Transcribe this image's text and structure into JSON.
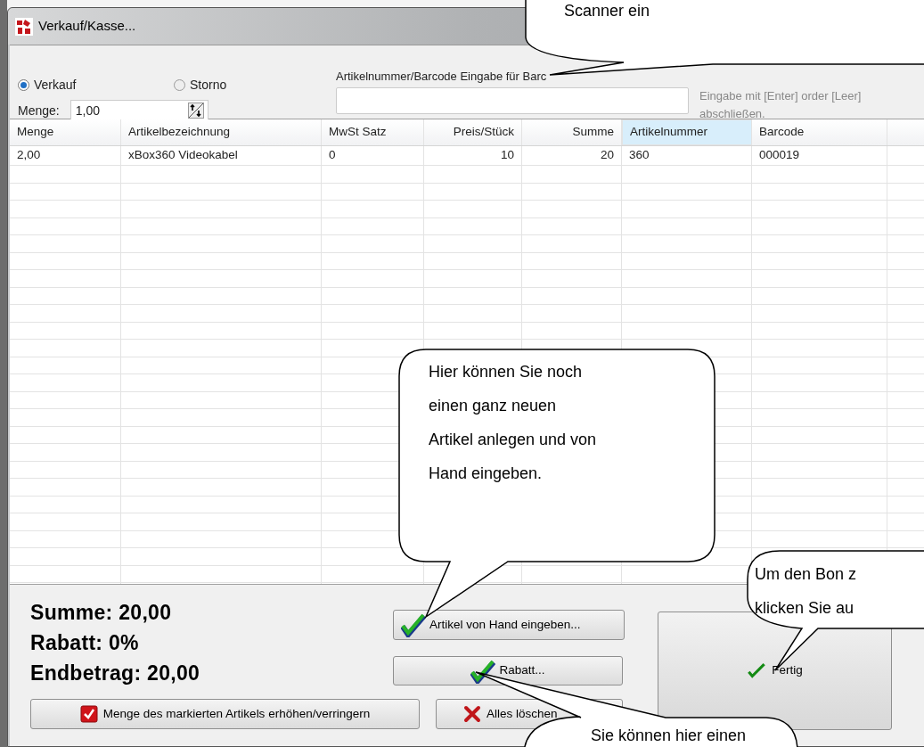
{
  "window": {
    "title": "Verkauf/Kasse..."
  },
  "mode_options": [
    {
      "label": "Verkauf",
      "selected": true
    },
    {
      "label": "Storno",
      "selected": false
    }
  ],
  "quantity": {
    "label": "Menge:",
    "value": "1,00"
  },
  "article_input": {
    "label": "Artikelnummer/Barcode Eingabe für Barc",
    "hint": "Eingabe mit [Enter] order [Leer] abschließen."
  },
  "table": {
    "columns": [
      {
        "label": "Menge",
        "selected": false
      },
      {
        "label": "Artikelbezeichnung",
        "selected": false
      },
      {
        "label": "MwSt Satz",
        "selected": false
      },
      {
        "label": "Preis/Stück",
        "selected": false
      },
      {
        "label": "Summe",
        "selected": false
      },
      {
        "label": "Artikelnummer",
        "selected": true
      },
      {
        "label": "Barcode",
        "selected": false
      }
    ],
    "rows": [
      [
        "2,00",
        "xBox360 Videokabel",
        "0",
        "10",
        "20",
        "360",
        "000019"
      ]
    ]
  },
  "totals": [
    "Summe: 20,00",
    "Rabatt: 0%",
    "Endbetrag: 20,00"
  ],
  "buttons": [
    {
      "kind": "check",
      "label": "Artikel von Hand eingeben..."
    },
    {
      "kind": "check",
      "label": "Rabatt..."
    },
    {
      "kind": "checkbox",
      "label": "Menge des markierten Artikels erhöhen/verringern"
    },
    {
      "kind": "cross",
      "label": "Alles löschen"
    },
    {
      "kind": "check",
      "label": "Fertig"
    }
  ],
  "callouts": [
    {
      "lines": [
        "Scanner ein"
      ]
    },
    {
      "lines": [
        "Hier können Sie noch",
        "einen ganz neuen",
        "Artikel anlegen und von",
        "Hand eingeben."
      ]
    },
    {
      "lines": [
        "Um den Bon z",
        "klicken Sie au"
      ]
    },
    {
      "lines": [
        "Sie können hier einen"
      ]
    }
  ]
}
